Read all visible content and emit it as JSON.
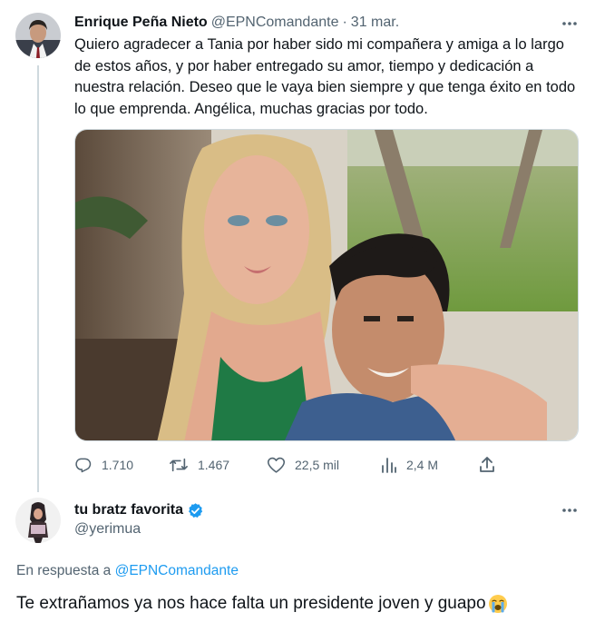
{
  "tweet": {
    "author_name": "Enrique Peña Nieto",
    "author_handle": "@EPNComandante",
    "separator": "·",
    "date": "31 mar.",
    "text": "Quiero agradecer a Tania por haber sido mi compañera y amiga a lo largo de estos años, y por haber entregado su amor, tiempo y dedicación a nuestra relación. Deseo que le vaya bien siempre y que tenga éxito en todo lo que emprenda. Angélica, muchas gracias por todo.",
    "replies": "1.710",
    "retweets": "1.467",
    "likes": "22,5 mil",
    "views": "2,4 M"
  },
  "reply": {
    "author_name": "tu bratz favorita",
    "author_handle": "@yerimua",
    "verified": true,
    "in_reply_prefix": "En respuesta a ",
    "in_reply_handle": "@EPNComandante",
    "text": "Te extrañamos ya nos hace falta un presidente joven y guapo",
    "emoji": "loudly-crying-face"
  },
  "colors": {
    "text": "#0f1419",
    "secondary": "#536471",
    "link": "#1d9bf0",
    "verified": "#1d9bf0",
    "thread_line": "#cfd9de"
  },
  "icons": [
    "more-icon",
    "reply-icon",
    "retweet-icon",
    "like-icon",
    "views-icon",
    "share-icon",
    "verified-badge-icon"
  ]
}
